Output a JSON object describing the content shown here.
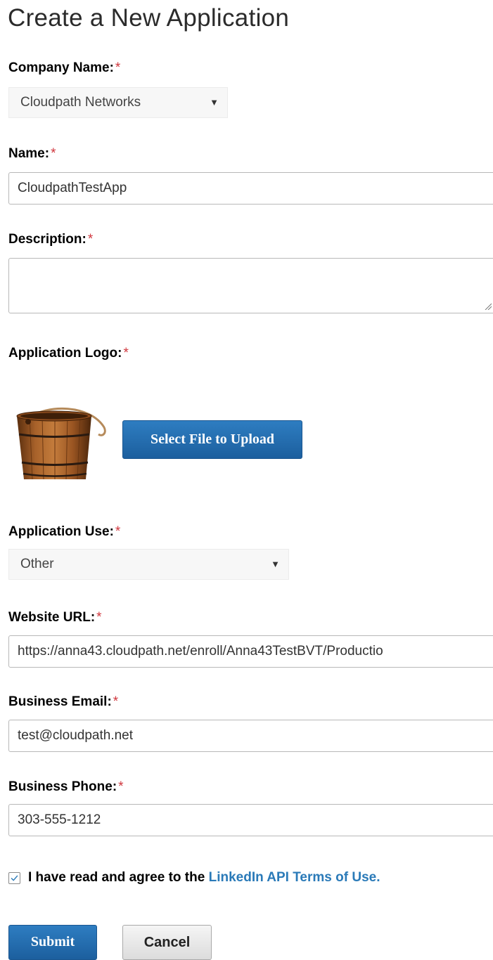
{
  "page": {
    "title": "Create a New Application"
  },
  "form": {
    "required_marker": "*",
    "company": {
      "label": "Company Name:",
      "value": "Cloudpath Networks"
    },
    "name": {
      "label": "Name:",
      "value": "CloudpathTestApp"
    },
    "description": {
      "label": "Description:",
      "value": ""
    },
    "logo": {
      "label": "Application Logo:",
      "upload_label": "Select File to Upload"
    },
    "use": {
      "label": "Application Use:",
      "value": "Other"
    },
    "website": {
      "label": "Website URL:",
      "value": "https://anna43.cloudpath.net/enroll/Anna43TestBVT/Productio"
    },
    "email": {
      "label": "Business Email:",
      "value": "test@cloudpath.net"
    },
    "phone": {
      "label": "Business Phone:",
      "value": "303-555-1212"
    },
    "terms": {
      "checked": true,
      "text": "I have read and agree to the",
      "link": "LinkedIn API Terms of Use."
    },
    "actions": {
      "submit_label": "Submit",
      "cancel_label": "Cancel"
    }
  },
  "colors": {
    "required": "#d0363d",
    "primary_button": "#1f67a8",
    "link": "#2a7ab8"
  },
  "icons": {
    "dropdown": "caret-down-icon",
    "check": "check-icon",
    "resize": "resize-grip-icon",
    "logo": "wooden-bucket-logo"
  }
}
